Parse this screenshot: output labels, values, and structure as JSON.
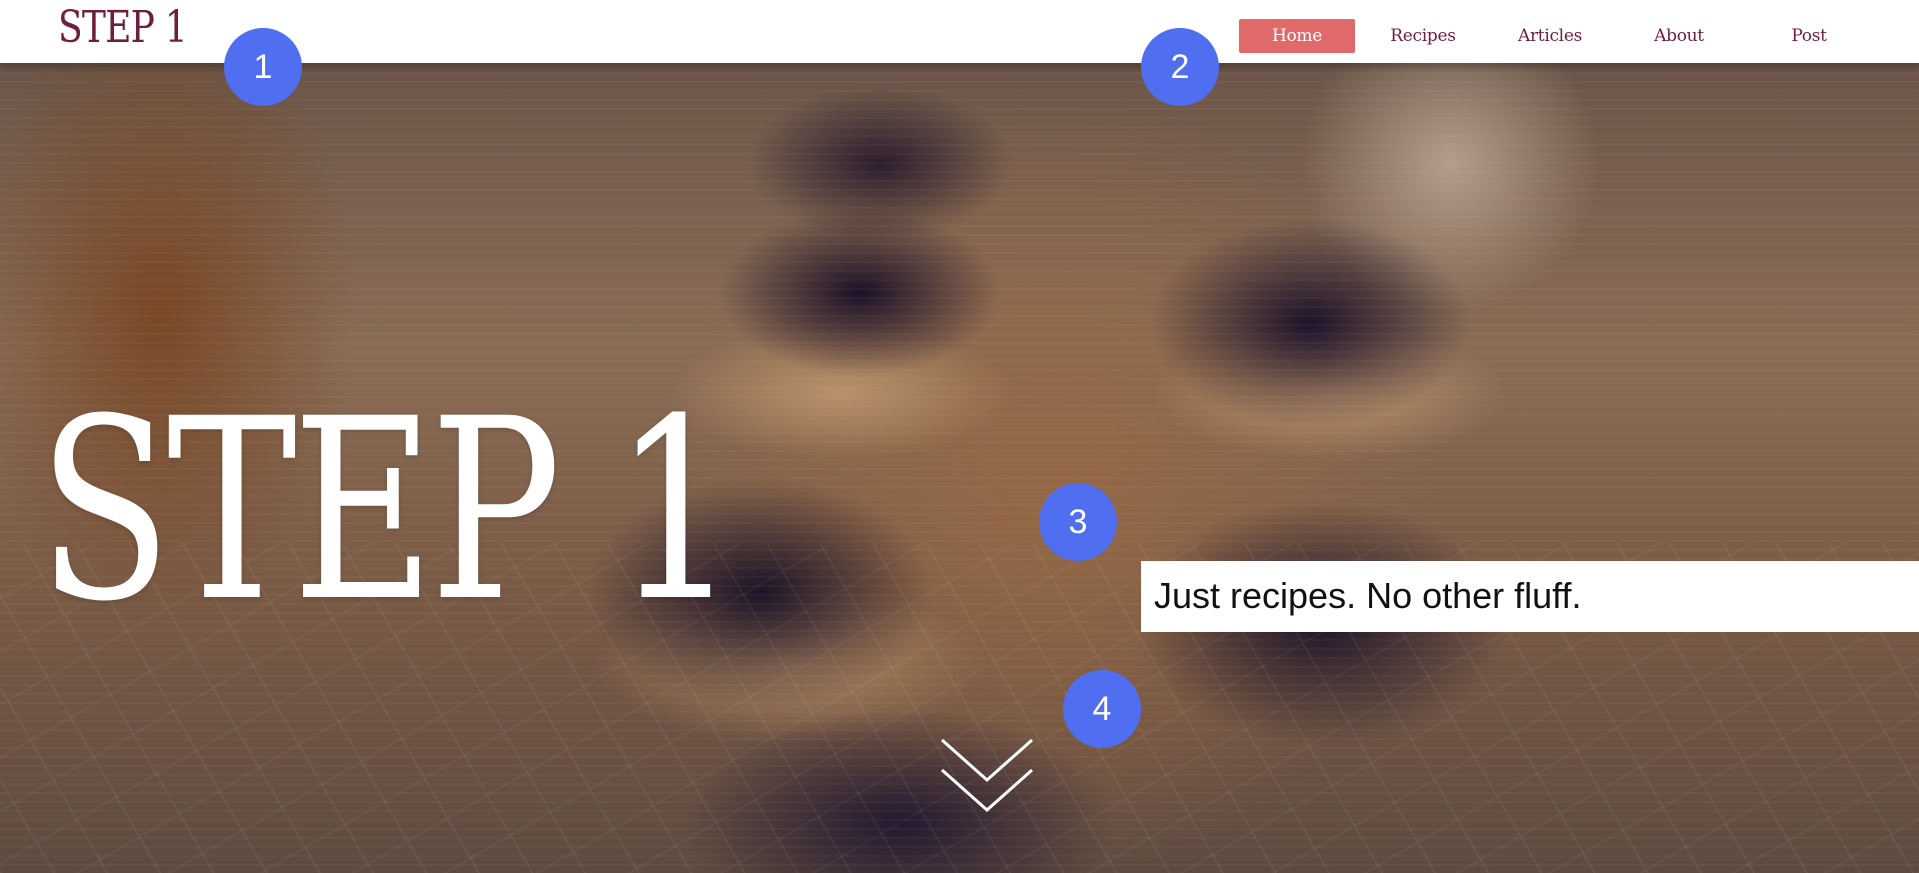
{
  "colors": {
    "brand": "#6e1f3d",
    "nav_active_bg": "#e06a6a",
    "nav_active_text": "#ffffff",
    "nav_text": "#6e1f3d",
    "marker": "#4f6ef0",
    "hero_title": "#ffffff",
    "tagline_bg": "#ffffff",
    "tagline_text": "#111111"
  },
  "header": {
    "logo": "STEP 1"
  },
  "nav": {
    "items": [
      {
        "label": "Home",
        "active": true
      },
      {
        "label": "Recipes",
        "active": false
      },
      {
        "label": "Articles",
        "active": false
      },
      {
        "label": "About",
        "active": false
      },
      {
        "label": "Post",
        "active": false
      }
    ]
  },
  "hero": {
    "title": "STEP 1",
    "tagline": "Just recipes. No other fluff.",
    "scroll_icon": "double-chevron-down-icon"
  },
  "markers": [
    "1",
    "2",
    "3",
    "4"
  ]
}
